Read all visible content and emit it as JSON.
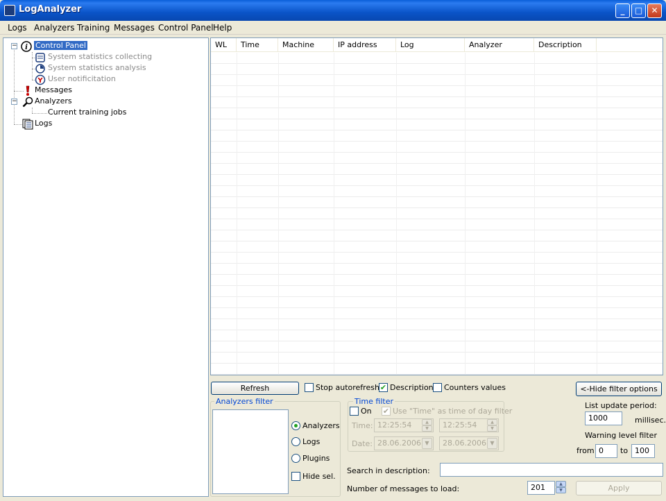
{
  "window": {
    "title": "LogAnalyzer"
  },
  "menu": [
    "Logs",
    "Analyzers",
    "Training",
    "Messages",
    "Control Panel",
    "Help"
  ],
  "tree": {
    "control_panel": "Control Panel",
    "sys_stats_collecting": "System statistics collecting",
    "sys_stats_analysis": "System statistics analysis",
    "user_notification": "User notificitation",
    "messages": "Messages",
    "analyzers": "Analyzers",
    "current_training_jobs": "Current training jobs",
    "logs": "Logs"
  },
  "grid": {
    "columns": [
      "WL",
      "Time",
      "Machine",
      "IP address",
      "Log",
      "Analyzer",
      "Description"
    ]
  },
  "controls": {
    "refresh": "Refresh",
    "stop_autorefresh": "Stop autorefresh",
    "description": "Description",
    "counters_values": "Counters values",
    "hide_filter": "<-Hide filter options",
    "list_update_period": "List update period:",
    "period_value": "1000",
    "millisec": "millisec.",
    "warning_level_filter": "Warning level filter",
    "from": "from",
    "from_value": "0",
    "to": "to",
    "to_value": "100",
    "search_label": "Search in description:",
    "search_value": "",
    "num_messages_label": "Number of messages to load:",
    "num_messages_value": "201",
    "apply": "Apply"
  },
  "analyzers_filter": {
    "title": "Analyzers filter",
    "options": [
      "Analyzers",
      "Logs",
      "Plugins"
    ],
    "selected": "Analyzers",
    "hide_sel": "Hide sel."
  },
  "time_filter": {
    "title": "Time filter",
    "on": "On",
    "use_time": "Use \"Time\" as time of day filter",
    "time_label": "Time:",
    "time_from": "12:25:54",
    "time_to": "12:25:54",
    "date_label": "Date:",
    "date_from": "28.06.2006",
    "date_to": "28.06.2006"
  }
}
